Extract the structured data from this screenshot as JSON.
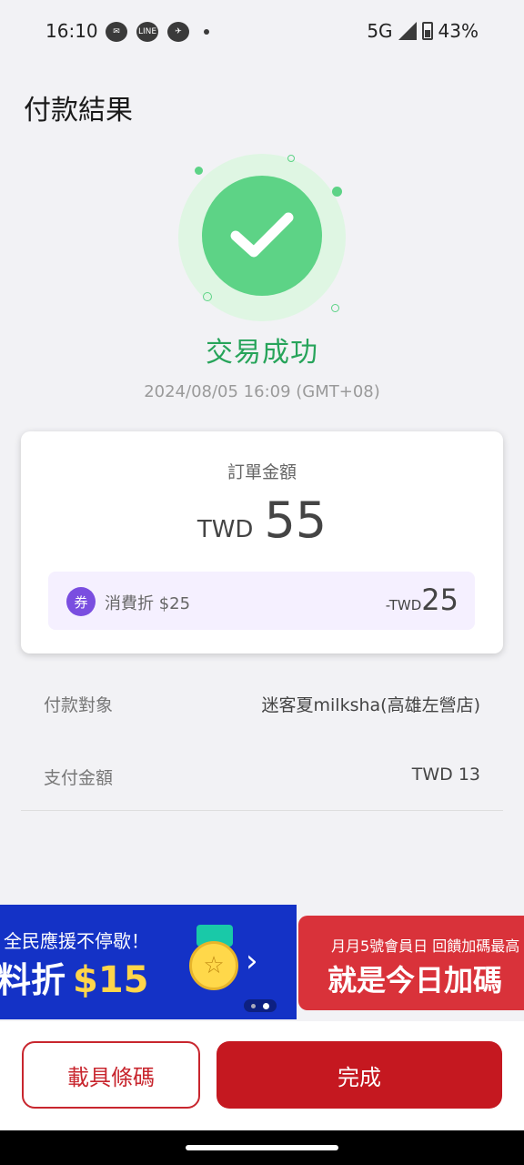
{
  "status_bar": {
    "time": "16:10",
    "app_icons": [
      "messenger-icon",
      "line-icon",
      "bird-icon"
    ],
    "network": "5G",
    "battery": "43%"
  },
  "page_title": "付款結果",
  "result": {
    "status": "交易成功",
    "timestamp": "2024/08/05 16:09 (GMT+08)",
    "accent_color": "#5dd386"
  },
  "order": {
    "label": "訂單金額",
    "currency": "TWD",
    "amount": "55",
    "discount": {
      "icon_text": "券",
      "label": "消費折 $25",
      "currency": "-TWD",
      "amount": "25"
    }
  },
  "details": [
    {
      "key": "付款對象",
      "value": "迷客夏milksha(高雄左營店)"
    },
    {
      "key": "支付金額",
      "value": "TWD 13"
    }
  ],
  "banners": {
    "blue": {
      "line1": "全民應援不停歇！",
      "line2_prefix": "料折",
      "line2_highlight": "$15"
    },
    "red": {
      "line1": "月月5號會員日 回饋加碼最高",
      "line2": "就是今日加碼"
    }
  },
  "buttons": {
    "carrier_barcode": "載具條碼",
    "done": "完成"
  },
  "colors": {
    "brand_red": "#c51820",
    "success_green": "#27a45a",
    "coupon_purple": "#7a4ee0"
  }
}
